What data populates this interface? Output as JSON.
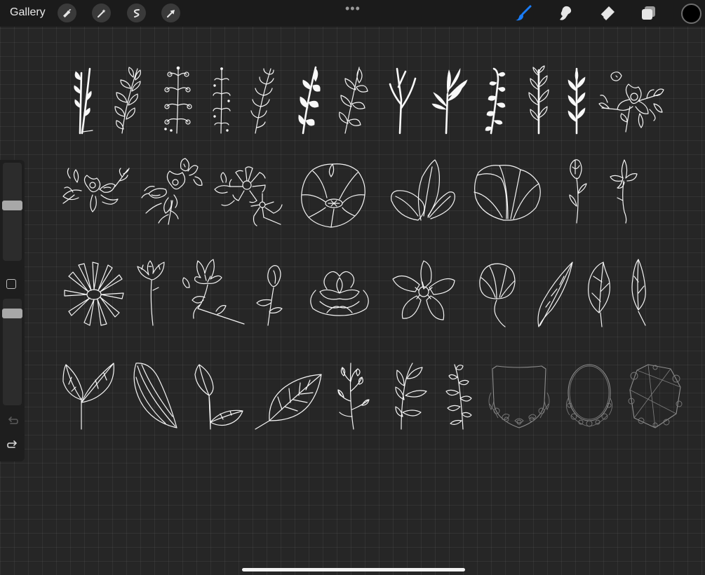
{
  "app": {
    "gallery_label": "Gallery",
    "colors": {
      "canvas_bg": "#262626",
      "toolbar_bg": "#1b1b1b",
      "active_brush": "#1a7cf5",
      "current_color": "#000000",
      "artwork_stroke": "#f4f4f4"
    }
  },
  "toolbar": {
    "left_tools": [
      "wrench-icon",
      "magic-wand-icon",
      "selection-icon",
      "transform-arrow-icon"
    ],
    "more_menu": "more-dots-icon",
    "right_tools": [
      "brush-icon",
      "smudge-icon",
      "eraser-icon",
      "layers-icon",
      "color-swatch"
    ],
    "active_tool": "brush-icon"
  },
  "sidebar": {
    "controls": [
      "brush-size-slider",
      "modify-button",
      "opacity-slider",
      "undo-icon",
      "redo-icon"
    ],
    "undo_enabled": false,
    "redo_enabled": true
  },
  "canvas": {
    "rows": [
      {
        "items": [
          "leafy-sprig",
          "leaf-branch",
          "berry-sprig",
          "dotted-sprig",
          "fern-sprig",
          "bold-leaf-branch",
          "outlined-leaf-branch",
          "twig",
          "coral-branch",
          "curly-sprig",
          "thin-leaf-branch",
          "narrow-leaf-branch",
          "floral-cluster"
        ]
      },
      {
        "items": [
          "floral-arrangement",
          "floral-bouquet",
          "daisy-cluster",
          "poppy-bloom",
          "tulip-petals",
          "open-petals",
          "rose-bud",
          "small-flower-stem"
        ]
      },
      {
        "items": [
          "daisy",
          "carnation-stem",
          "magnolia-branch",
          "bud-stem",
          "peony",
          "anemone",
          "closed-bud",
          "long-leaf",
          "veined-leaf",
          "slim-leaf"
        ]
      },
      {
        "items": [
          "two-leaves",
          "big-petal",
          "leaf-pair",
          "large-leaf",
          "herb-sprig",
          "eucalyptus-sprig",
          "round-leaf-sprig",
          "shield-frame",
          "oval-frame",
          "geometric-frame"
        ]
      }
    ]
  }
}
